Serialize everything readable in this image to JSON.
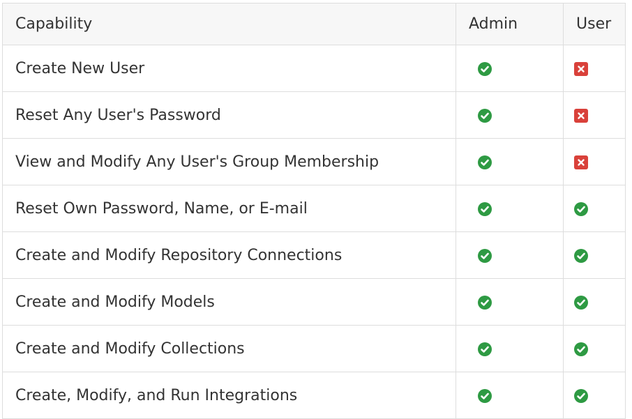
{
  "table": {
    "headers": {
      "capability": "Capability",
      "admin": "Admin",
      "user": "User"
    },
    "rows": [
      {
        "capability": "Create New User",
        "admin": "allowed",
        "user": "denied"
      },
      {
        "capability": "Reset Any User's Password",
        "admin": "allowed",
        "user": "denied"
      },
      {
        "capability": "View and Modify Any User's Group Membership",
        "admin": "allowed",
        "user": "denied"
      },
      {
        "capability": "Reset Own Password, Name, or E-mail",
        "admin": "allowed",
        "user": "allowed"
      },
      {
        "capability": "Create and Modify Repository Connections",
        "admin": "allowed",
        "user": "allowed"
      },
      {
        "capability": "Create and Modify Models",
        "admin": "allowed",
        "user": "allowed"
      },
      {
        "capability": "Create and Modify Collections",
        "admin": "allowed",
        "user": "allowed"
      },
      {
        "capability": "Create, Modify, and Run Integrations",
        "admin": "allowed",
        "user": "allowed"
      }
    ]
  },
  "icons": {
    "allowed": "check-circle-icon",
    "denied": "x-square-icon"
  },
  "colors": {
    "allowed": "#2e9a43",
    "denied": "#d9413a",
    "header_bg": "#f7f7f7",
    "border": "#dddddd",
    "text": "#333333"
  }
}
